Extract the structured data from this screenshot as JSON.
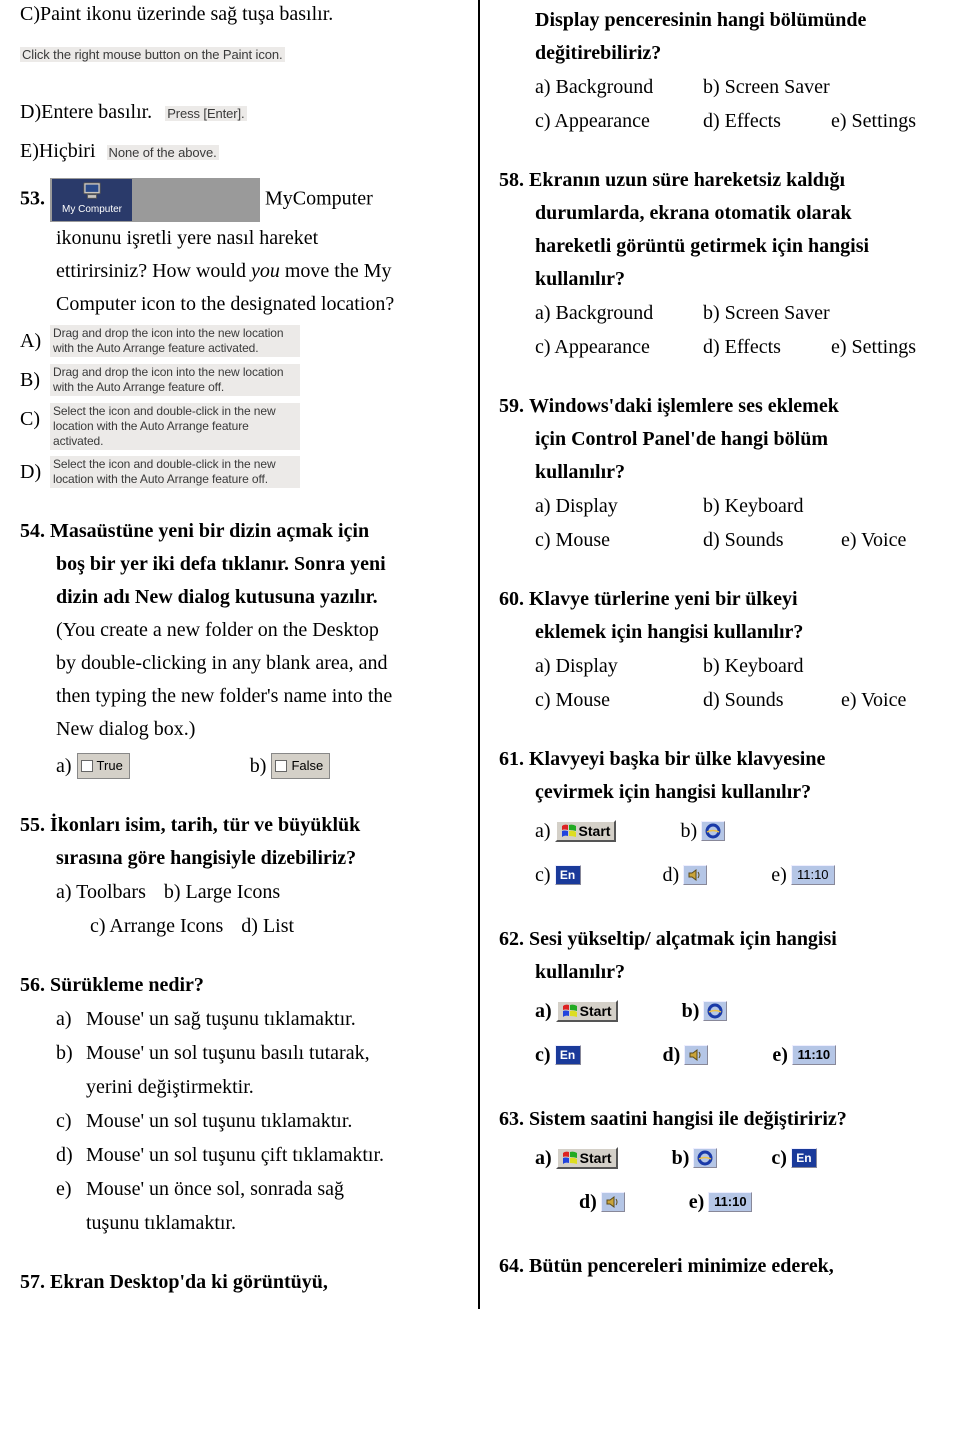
{
  "left": {
    "c_text": "C)Paint ikonu üzerinde sağ tuşa basılır.",
    "c_hint": "Click the right mouse button on the Paint icon.",
    "d_text": "D)Entere  basılır.",
    "d_hint": "Press [Enter].",
    "e_text": "E)Hiçbiri",
    "e_hint": "None of the above.",
    "q53": {
      "num": "53.",
      "after_icon": "MyComputer",
      "line2": "ikonunu işretli yere nasıl hareket",
      "line3_a": "ettirirsiniz? How would ",
      "line3_em": "you",
      "line3_b": " move the My",
      "line4": "Computer icon to the designated location?",
      "a_hint": "Drag and drop the icon into the new location with the Auto Arrange feature activated.",
      "b_hint": "Drag and drop the icon into the new location with the Auto Arrange feature off.",
      "c_hint": "Select the icon and double-click in the new location with the Auto Arrange feature activated.",
      "d_hint": "Select the icon and double-click in the new location with the Auto Arrange feature off.",
      "mycomputer_label": "My Computer"
    },
    "q54": {
      "num": "54.",
      "bold1": "Masaüstüne yeni bir dizin açmak için",
      "bold2": "boş bir yer iki defa tıklanır. Sonra yeni",
      "bold3": "dizin adı New dialog kutusuna yazılır.",
      "plain1": "(You create a new folder on the Desktop",
      "plain2": "by double-clicking in any blank area, and",
      "plain3": "then typing the new folder's name into the",
      "plain4": "New dialog box.)",
      "a_label": "a)",
      "true_text": "True",
      "b_label": "b)",
      "false_text": "False"
    },
    "q55": {
      "num": "55.",
      "bold1": "İkonları isim, tarih, tür ve büyüklük",
      "bold2": "sırasına göre hangisiyle dizebiliriz?",
      "a": "a) Toolbars",
      "b": "b) Large Icons",
      "c": "c) Arrange Icons",
      "d": "d) List"
    },
    "q56": {
      "num": "56.",
      "bold": "Sürükleme nedir?",
      "a": "Mouse' un sağ tuşunu tıklamaktır.",
      "b1": "Mouse' un sol tuşunu basılı tutarak,",
      "b2": "yerini değiştirmektir.",
      "c": "Mouse' un sol tuşunu tıklamaktır.",
      "d": "Mouse' un sol tuşunu çift tıklamaktır.",
      "e1": "Mouse' un önce sol, sonrada sağ",
      "e2": "tuşunu tıklamaktır."
    },
    "q57": {
      "num": "57.",
      "bold": "Ekran Desktop'da  ki görüntüyü,"
    }
  },
  "right": {
    "q57cont": {
      "bold1": "Display penceresinin hangi bölümünde",
      "bold2": "değitirebiliriz?",
      "a": "a) Background",
      "b": "b) Screen Saver",
      "c": "c) Appearance",
      "d": "d) Effects",
      "e": "e) Settings"
    },
    "q58": {
      "num": "58.",
      "bold1": "Ekranın uzun süre hareketsiz kaldığı",
      "bold2": "durumlarda, ekrana otomatik olarak",
      "bold3": "hareketli görüntü getirmek için hangisi",
      "bold4": "kullanılır?",
      "a": "a) Background",
      "b": "b) Screen Saver",
      "c": "c) Appearance",
      "d": "d) Effects",
      "e": "e) Settings"
    },
    "q59": {
      "num": "59.",
      "bold1": "Windows'daki işlemlere ses eklemek",
      "bold2": "için Control Panel'de hangi bölüm",
      "bold3": "kullanılır?",
      "a": "a) Display",
      "b": "b) Keyboard",
      "c": "c) Mouse",
      "d": "d) Sounds",
      "e": "e) Voice"
    },
    "q60": {
      "num": "60.",
      "bold1": "Klavye türlerine yeni bir ülkeyi",
      "bold2": "eklemek için hangisi kullanılır?",
      "a": "a) Display",
      "b": "b) Keyboard",
      "c": "c) Mouse",
      "d": "d) Sounds",
      "e": "e) Voice"
    },
    "q61": {
      "num": "61.",
      "bold1": "Klavyeyi başka bir ülke klavyesine",
      "bold2": "çevirmek için hangisi kullanılır?"
    },
    "q62": {
      "num": "62.",
      "bold1": "Sesi yükseltip/ alçatmak için hangisi",
      "bold2": "kullanılır?"
    },
    "q63": {
      "num": "63.",
      "bold": "Sistem saatini hangisi ile değiştiririz?"
    },
    "q64": {
      "num": "64.",
      "bold": "Bütün pencereleri minimize ederek,"
    },
    "icons": {
      "start": "Start",
      "lang": "En",
      "time": "11:10",
      "a": "a)",
      "b": "b)",
      "c": "c)",
      "d": "d)",
      "e": "e)"
    }
  }
}
